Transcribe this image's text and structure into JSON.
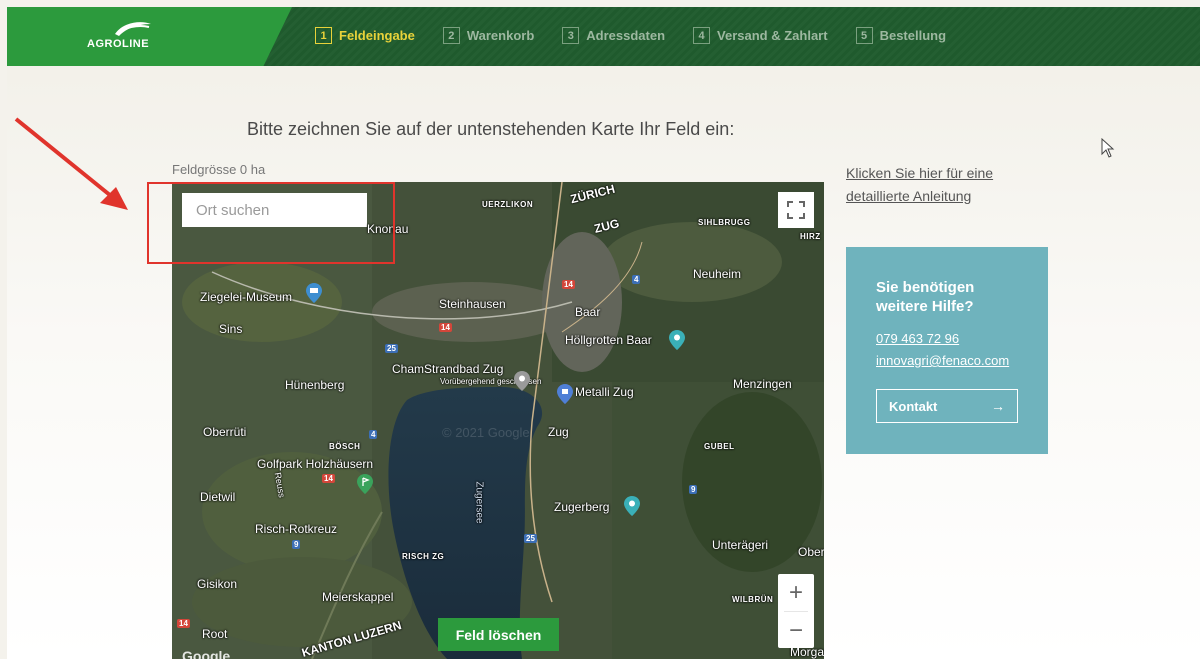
{
  "brand": {
    "name": "AGROLINE",
    "color": "#2c9a3d",
    "header_color": "#1f5a2d"
  },
  "steps": [
    {
      "num": "1",
      "label": "Feldeingabe",
      "active": true
    },
    {
      "num": "2",
      "label": "Warenkorb",
      "active": false
    },
    {
      "num": "3",
      "label": "Adressdaten",
      "active": false
    },
    {
      "num": "4",
      "label": "Versand & Zahlart",
      "active": false
    },
    {
      "num": "5",
      "label": "Bestellung",
      "active": false
    }
  ],
  "main": {
    "instruction": "Bitte zeichnen Sie auf der untenstehenden Karte Ihr Feld ein:",
    "field_size": "Feldgrösse 0 ha"
  },
  "map": {
    "search_placeholder": "Ort suchen",
    "delete_label": "Feld löschen",
    "zoom_in": "+",
    "zoom_out": "−",
    "provider": "Google",
    "copyright": "© 2021 Google",
    "labels": {
      "zurich": "ZÜRICH",
      "knonau": "Knonau",
      "uerzlikon": "UERZLIKON",
      "zug_top": "ZUG",
      "sihlbrugg": "SIHLBRUGG",
      "hirz": "HIRZ",
      "neuheim": "Neuheim",
      "ziegelei": "Ziegelei-Museum",
      "steinhausen": "Steinhausen",
      "baar": "Baar",
      "sins": "Sins",
      "hoellgrotten": "Höllgrotten Baar",
      "cham": "Cham",
      "strandbad": "Strandbad Zug",
      "closed": "Vorübergehend geschlossen",
      "metalli": "Metalli Zug",
      "huenenberg": "Hünenberg",
      "menzingen": "Menzingen",
      "oberrueti": "Oberrüti",
      "bosch": "BÖSCH",
      "zug": "Zug",
      "gubel": "GUBEL",
      "golfpark": "Golfpark Holzhäusern",
      "reuss": "Reuss",
      "dietwil": "Dietwil",
      "zugersee": "Zugersee",
      "zugerberg": "Zugerberg",
      "risch_rotkreuz": "Risch-Rotkreuz",
      "unteraegeri": "Unterägeri",
      "ober": "Ober",
      "risch_zg": "RISCH ZG",
      "gisikon": "Gisikon",
      "meierskappel": "Meierskappel",
      "wilbruen": "WILBRÜN",
      "root": "Root",
      "kanton_luzern": "KANTON LUZERN",
      "morgar": "Morgar"
    },
    "road_numbers": [
      "14",
      "4",
      "14",
      "25",
      "4",
      "14",
      "9",
      "25",
      "9",
      "14"
    ]
  },
  "sidebar": {
    "guide_link": "Klicken Sie hier für eine detaillierte Anleitung",
    "help_title": "Sie benötigen weitere Hilfe?",
    "phone": "079 463 72 96",
    "email": "innovagri@fenaco.com",
    "contact_label": "Kontakt",
    "contact_arrow": "→",
    "box_color": "#6fb3bd"
  },
  "annotation": {
    "color": "#e0342c"
  }
}
